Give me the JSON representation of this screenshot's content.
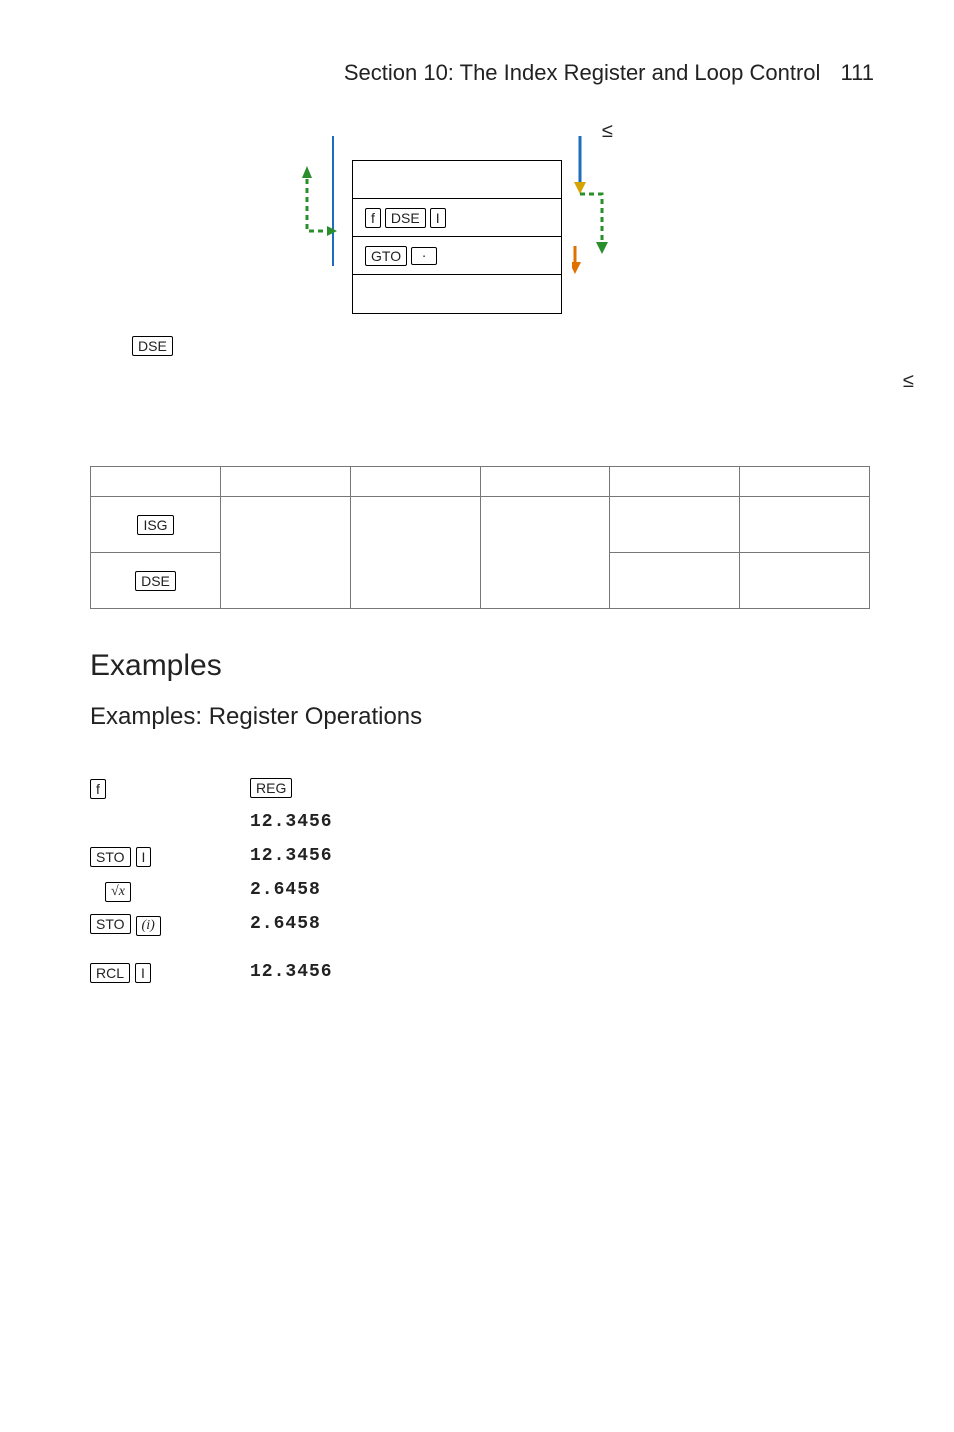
{
  "header": {
    "title": "Section 10: The Index Register and Loop Control",
    "page": "111"
  },
  "diagram": {
    "le_top": "≤",
    "keys": {
      "f": "f",
      "dse": "DSE",
      "I": "I",
      "gto": "GTO",
      "dot": "·"
    },
    "dse_below": "DSE",
    "le_right": "≤"
  },
  "table": {
    "rows": [
      {
        "label": "ISG"
      },
      {
        "label": "DSE"
      }
    ]
  },
  "examples_heading": "Examples",
  "subheading": "Examples: Register Operations",
  "ops": {
    "row1": {
      "k1": "f",
      "k2": "REG"
    },
    "row2": {
      "val": "12.3456"
    },
    "row3": {
      "k1": "STO",
      "k2": "I",
      "val": "12.3456"
    },
    "row4": {
      "k1_html": "√x",
      "val": "2.6458"
    },
    "row5": {
      "k1": "STO",
      "k2_html": "(i)",
      "val": "2.6458"
    },
    "row6": {
      "k1": "RCL",
      "k2": "I",
      "val": "12.3456"
    }
  }
}
